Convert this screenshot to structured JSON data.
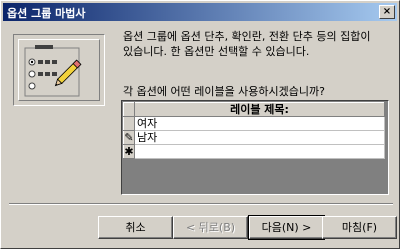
{
  "window": {
    "title": "옵션 그룹 마법사",
    "close_glyph": "×"
  },
  "description": {
    "line1": "옵션 그룹에 옵션 단추, 확인란, 전환 단추 등의 집합이",
    "line2": "있습니다. 한 옵션만 선택할 수 있습니다."
  },
  "question": "각 옵션에 어떤 레이블을 사용하시겠습니까?",
  "grid": {
    "header": "레이블 제목:",
    "rows": [
      {
        "selector": "",
        "label": "여자"
      },
      {
        "selector": "✎",
        "label": "남자"
      },
      {
        "selector": "✱",
        "label": ""
      }
    ]
  },
  "buttons": {
    "cancel": "취소",
    "back": "< 뒤로(B)",
    "next": "다음(N) >",
    "finish": "마침(F)"
  },
  "icons": {
    "illustration": "option-group-illustration-icon",
    "edit": "pencil-icon",
    "new_row": "asterisk-icon"
  }
}
